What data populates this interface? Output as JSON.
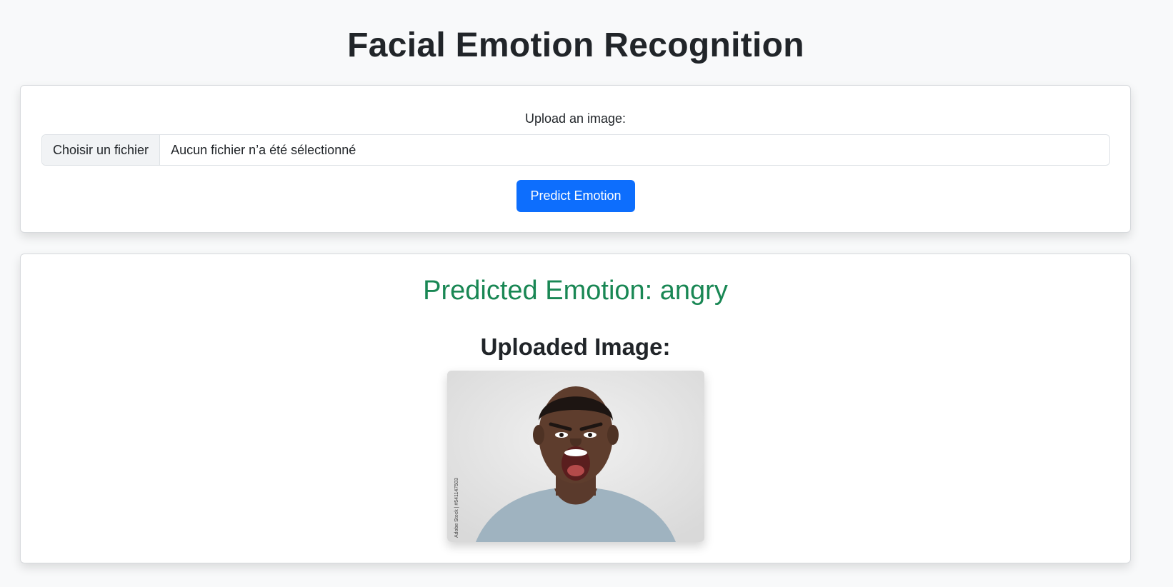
{
  "page": {
    "title": "Facial Emotion Recognition"
  },
  "upload_form": {
    "label": "Upload an image:",
    "file_button_label": "Choisir un fichier",
    "file_status": "Aucun fichier n’a été sélectionné",
    "submit_label": "Predict Emotion"
  },
  "result": {
    "predicted_text": "Predicted Emotion: angry",
    "uploaded_heading": "Uploaded Image:",
    "image_watermark": "Adobe Stock | #541147503"
  },
  "colors": {
    "page_background": "#f8f9fa",
    "primary_button": "#0d6efd",
    "success_text": "#198754"
  }
}
